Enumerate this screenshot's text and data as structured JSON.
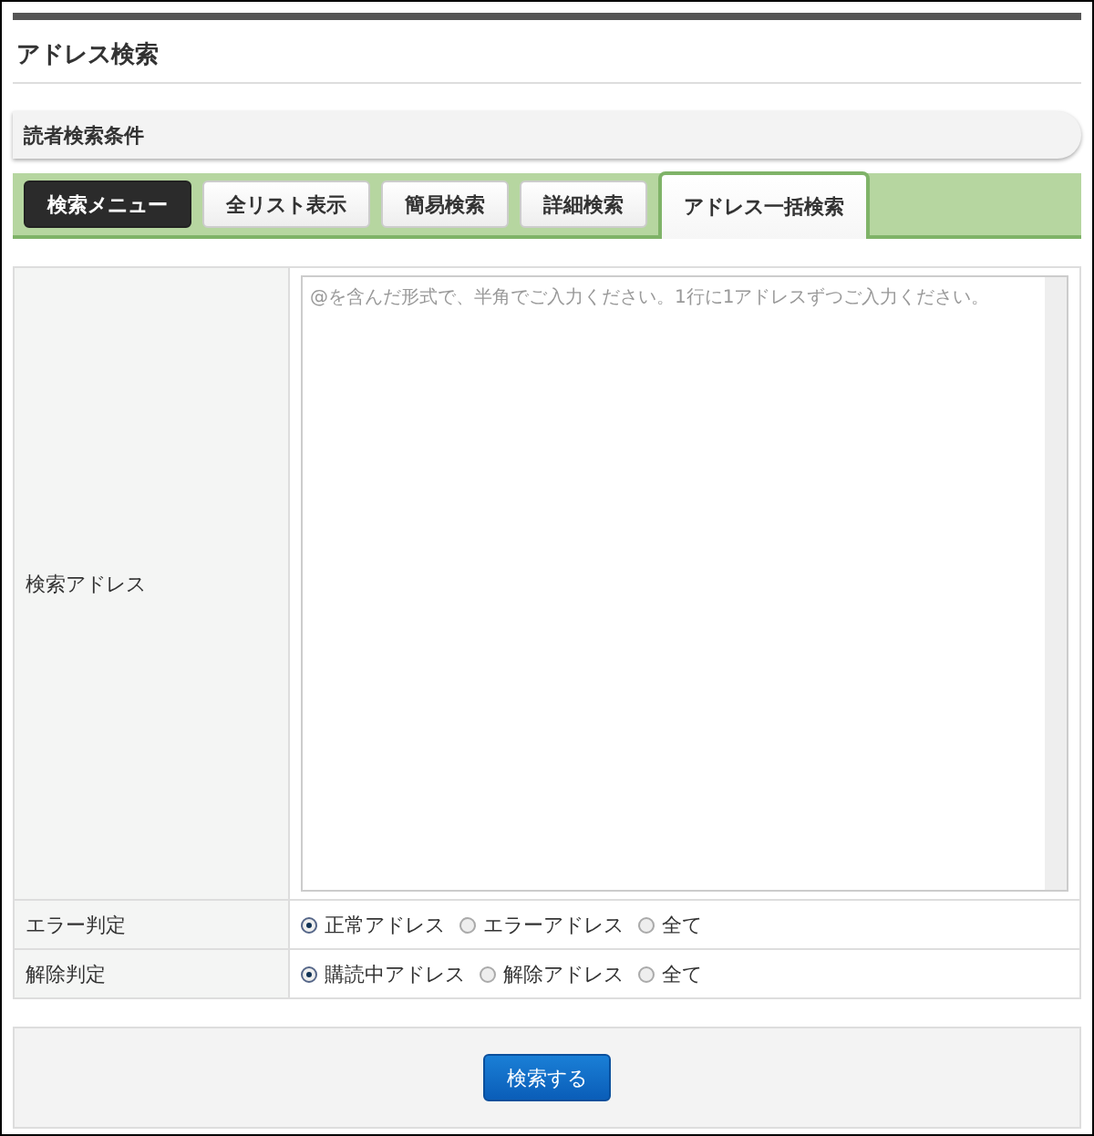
{
  "page": {
    "title": "アドレス検索"
  },
  "section": {
    "title": "読者検索条件"
  },
  "tabs": [
    {
      "label": "検索メニュー",
      "kind": "menu",
      "selected": false
    },
    {
      "label": "全リスト表示",
      "kind": "tab",
      "selected": false
    },
    {
      "label": "簡易検索",
      "kind": "tab",
      "selected": false
    },
    {
      "label": "詳細検索",
      "kind": "tab",
      "selected": false
    },
    {
      "label": "アドレス一括検索",
      "kind": "tab",
      "selected": true
    }
  ],
  "form": {
    "address": {
      "label": "検索アドレス",
      "placeholder": "@を含んだ形式で、半角でご入力ください。1行に1アドレスずつご入力ください。"
    },
    "radio_rows": [
      {
        "label": "エラー判定",
        "options": [
          {
            "label": "正常アドレス",
            "selected": true
          },
          {
            "label": "エラーアドレス",
            "selected": false
          },
          {
            "label": "全て",
            "selected": false
          }
        ]
      },
      {
        "label": "解除判定",
        "options": [
          {
            "label": "購読中アドレス",
            "selected": true
          },
          {
            "label": "解除アドレス",
            "selected": false
          },
          {
            "label": "全て",
            "selected": false
          }
        ]
      }
    ]
  },
  "submit": {
    "label": "検索する"
  }
}
